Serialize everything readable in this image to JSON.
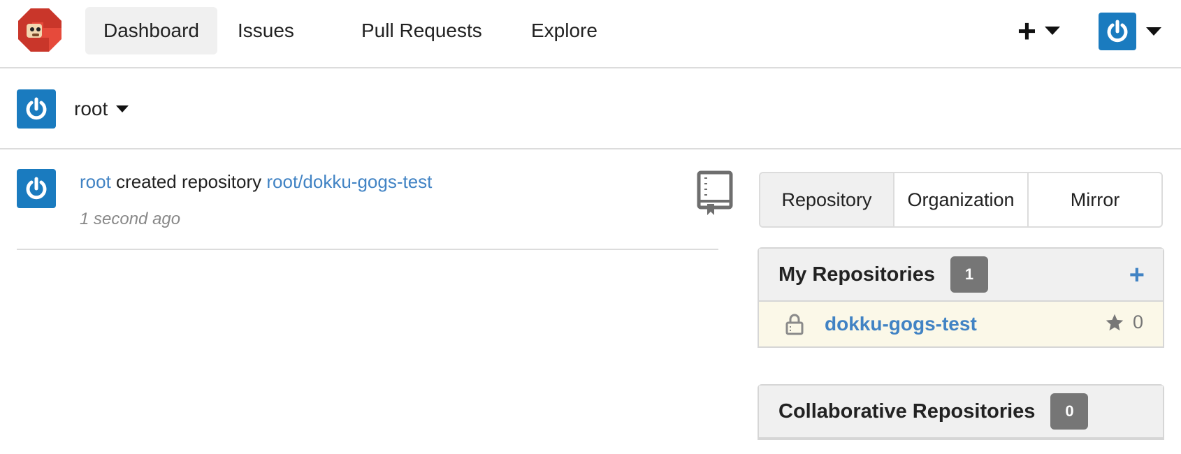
{
  "nav": {
    "items": [
      {
        "label": "Dashboard",
        "active": true
      },
      {
        "label": "Issues",
        "active": false
      },
      {
        "label": "Pull Requests",
        "active": false
      },
      {
        "label": "Explore",
        "active": false
      }
    ],
    "create_icon": "plus-icon",
    "user_icon": "power-avatar-icon"
  },
  "context": {
    "username": "root"
  },
  "feed": [
    {
      "actor": "root",
      "action": "created repository",
      "target": "root/dokku-gogs-test",
      "time": "1 second ago",
      "icon": "repo-book-icon"
    }
  ],
  "tabs": [
    "Repository",
    "Organization",
    "Mirror"
  ],
  "my_repositories": {
    "title": "My Repositories",
    "count": "1",
    "repos": [
      {
        "name": "dokku-gogs-test",
        "private": true,
        "stars": "0"
      }
    ]
  },
  "collaborative_repositories": {
    "title": "Collaborative Repositories",
    "count": "0"
  },
  "colors": {
    "link": "#4183c4",
    "avatar": "#1a7bbf",
    "badge": "#767676",
    "highlight_row": "#fbf8e8"
  }
}
